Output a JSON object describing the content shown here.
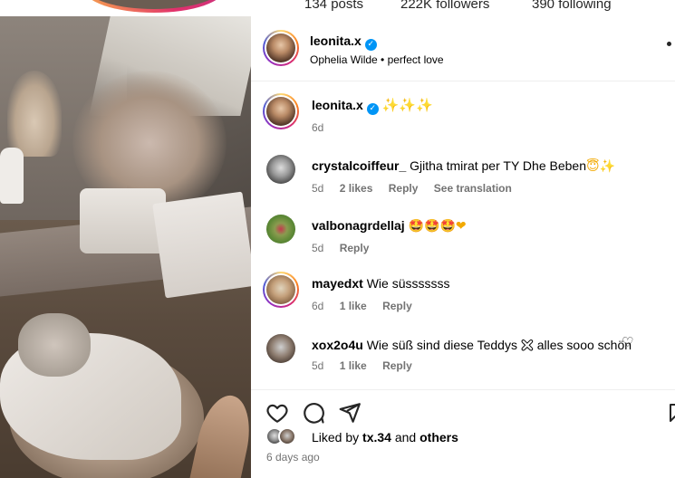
{
  "profile_header": {
    "posts": "134 posts",
    "followers": "222K followers",
    "following": "390 following"
  },
  "post": {
    "username": "leonita.x",
    "subtitle": "Ophelia Wilde • perfect love",
    "caption_username": "leonita.x",
    "caption_text": "✨✨✨",
    "caption_age": "6d"
  },
  "comments": [
    {
      "username": "crystalcoiffeur_",
      "text": "Gjitha tmirat per TY Dhe Beben",
      "emoji": "😇✨",
      "age": "5d",
      "likes": "2 likes",
      "reply": "Reply",
      "translate": "See translation"
    },
    {
      "username": "valbonagrdellaj",
      "text": "",
      "emoji": "🤩🤩🤩❤",
      "age": "5d",
      "likes": "",
      "reply": "Reply",
      "translate": ""
    },
    {
      "username": "mayedxt",
      "text": "Wie süsssssss",
      "emoji": "",
      "age": "6d",
      "likes": "1 like",
      "reply": "Reply",
      "translate": ""
    },
    {
      "username": "xox2o4u",
      "text": "Wie süß sind diese Teddys 🯀 alles sooo schön",
      "emoji": "",
      "age": "5d",
      "likes": "1 like",
      "reply": "Reply",
      "translate": ""
    }
  ],
  "likes": {
    "liked_by": "Liked by",
    "user": "tx.34",
    "and": "and",
    "others": "others"
  },
  "time_ago": "6 days ago",
  "colors": {
    "verified": "#0095f6",
    "meta_gray": "#737373",
    "divider": "#efefef"
  },
  "icons": [
    "verified-badge-icon",
    "more-options-icon",
    "heart-icon",
    "comment-icon",
    "share-icon",
    "save-icon"
  ]
}
